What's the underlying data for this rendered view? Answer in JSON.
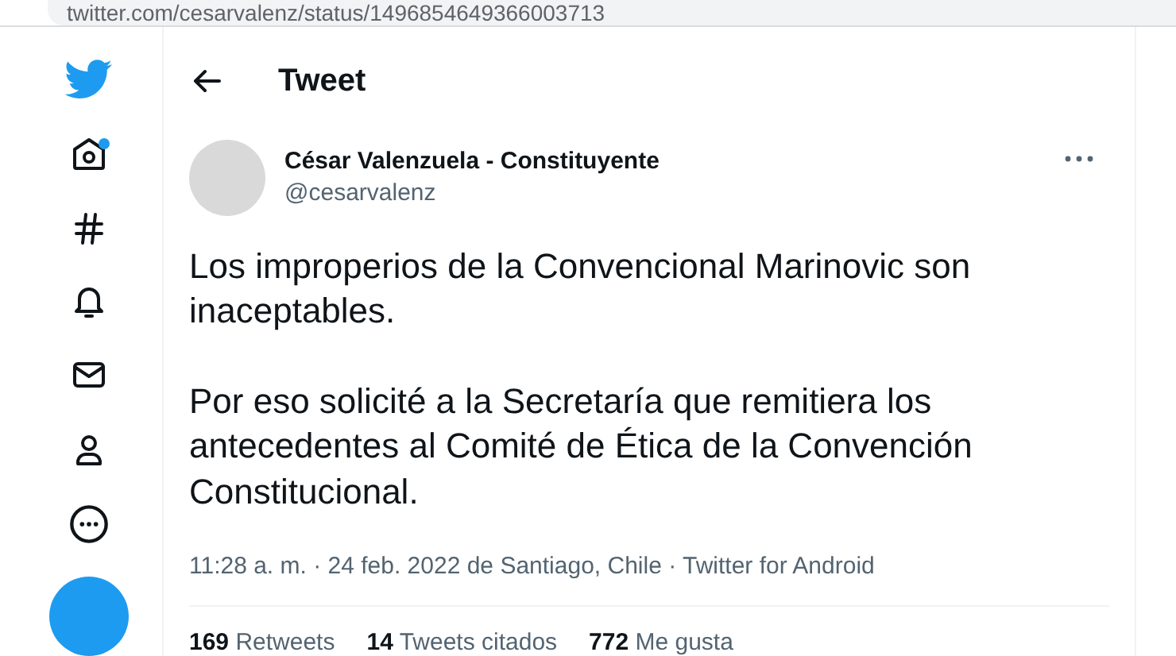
{
  "browser": {
    "url": "twitter.com/cesarvalenz/status/1496854649366003713"
  },
  "sidebar": {
    "items": [
      {
        "kind": "logo",
        "badge": false
      },
      {
        "kind": "home",
        "badge": true
      },
      {
        "kind": "explore",
        "badge": false
      },
      {
        "kind": "notifications",
        "badge": false
      },
      {
        "kind": "messages",
        "badge": false
      },
      {
        "kind": "profile",
        "badge": false
      },
      {
        "kind": "more",
        "badge": false
      },
      {
        "kind": "compose",
        "badge": false
      }
    ]
  },
  "header": {
    "title": "Tweet"
  },
  "tweet": {
    "author": "César Valenzuela - Constituyente",
    "handle": "@cesarvalenz",
    "paragraphs": [
      "Los improperios de la Convencional Marinovic son inaceptables.",
      "Por eso solicité a la Secretaría que remitiera los antecedentes al Comité de Ética de la Convención Constitucional."
    ],
    "meta": "11:28 a. m. · 24 feb. 2022 de Santiago, Chile · Twitter for Android",
    "stats": [
      "**169** Retweets",
      "**14** Tweets citados",
      "**772** Me gusta"
    ]
  }
}
